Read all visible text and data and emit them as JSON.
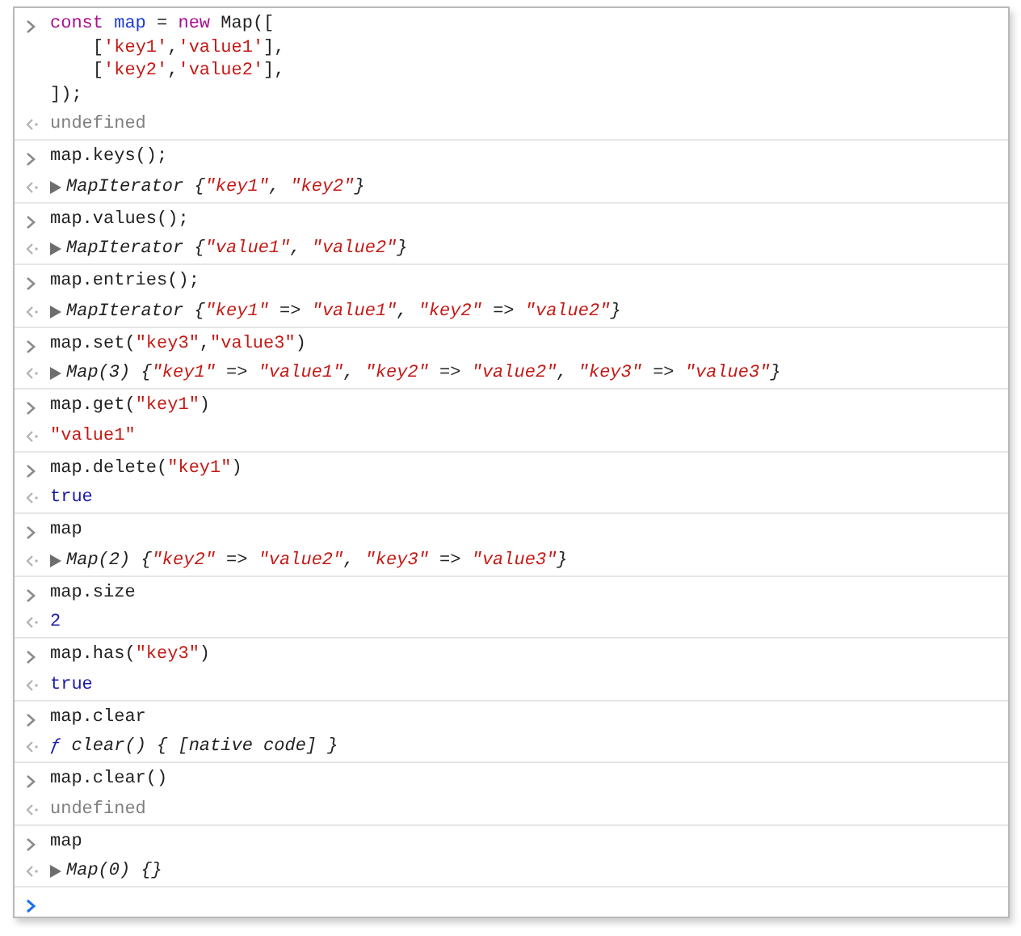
{
  "console": {
    "entries": [
      {
        "input": [
          [
            {
              "text": "const ",
              "kind": "keyword"
            },
            {
              "text": "map",
              "kind": "def"
            },
            {
              "text": " = ",
              "kind": "plain"
            },
            {
              "text": "new ",
              "kind": "keyword"
            },
            {
              "text": "Map([",
              "kind": "plain"
            }
          ],
          [
            {
              "text": "    [",
              "kind": "plain"
            },
            {
              "text": "'key1'",
              "kind": "string"
            },
            {
              "text": ",",
              "kind": "plain"
            },
            {
              "text": "'value1'",
              "kind": "string"
            },
            {
              "text": "],",
              "kind": "plain"
            }
          ],
          [
            {
              "text": "    [",
              "kind": "plain"
            },
            {
              "text": "'key2'",
              "kind": "string"
            },
            {
              "text": ",",
              "kind": "plain"
            },
            {
              "text": "'value2'",
              "kind": "string"
            },
            {
              "text": "],",
              "kind": "plain"
            }
          ],
          [
            {
              "text": "]);",
              "kind": "plain"
            }
          ]
        ],
        "output": {
          "kind": "value",
          "expandable": false,
          "tokens": [
            {
              "text": "undefined",
              "kind": "null"
            }
          ]
        }
      },
      {
        "input": [
          [
            {
              "text": "map.keys();",
              "kind": "plain"
            }
          ]
        ],
        "output": {
          "kind": "object",
          "expandable": true,
          "tokens": [
            {
              "text": "MapIterator {",
              "kind": "plain"
            },
            {
              "text": "\"key1\"",
              "kind": "string"
            },
            {
              "text": ", ",
              "kind": "plain"
            },
            {
              "text": "\"key2\"",
              "kind": "string"
            },
            {
              "text": "}",
              "kind": "plain"
            }
          ]
        }
      },
      {
        "input": [
          [
            {
              "text": "map.values();",
              "kind": "plain"
            }
          ]
        ],
        "output": {
          "kind": "object",
          "expandable": true,
          "tokens": [
            {
              "text": "MapIterator {",
              "kind": "plain"
            },
            {
              "text": "\"value1\"",
              "kind": "string"
            },
            {
              "text": ", ",
              "kind": "plain"
            },
            {
              "text": "\"value2\"",
              "kind": "string"
            },
            {
              "text": "}",
              "kind": "plain"
            }
          ]
        }
      },
      {
        "input": [
          [
            {
              "text": "map.entries();",
              "kind": "plain"
            }
          ]
        ],
        "output": {
          "kind": "object",
          "expandable": true,
          "tokens": [
            {
              "text": "MapIterator {",
              "kind": "plain"
            },
            {
              "text": "\"key1\"",
              "kind": "string"
            },
            {
              "text": " => ",
              "kind": "plain"
            },
            {
              "text": "\"value1\"",
              "kind": "string"
            },
            {
              "text": ", ",
              "kind": "plain"
            },
            {
              "text": "\"key2\"",
              "kind": "string"
            },
            {
              "text": " => ",
              "kind": "plain"
            },
            {
              "text": "\"value2\"",
              "kind": "string"
            },
            {
              "text": "}",
              "kind": "plain"
            }
          ]
        }
      },
      {
        "input": [
          [
            {
              "text": "map.set(",
              "kind": "plain"
            },
            {
              "text": "\"key3\"",
              "kind": "string"
            },
            {
              "text": ",",
              "kind": "plain"
            },
            {
              "text": "\"value3\"",
              "kind": "string"
            },
            {
              "text": ")",
              "kind": "plain"
            }
          ]
        ],
        "output": {
          "kind": "object",
          "expandable": true,
          "tokens": [
            {
              "text": "Map(3) {",
              "kind": "plain"
            },
            {
              "text": "\"key1\"",
              "kind": "string"
            },
            {
              "text": " => ",
              "kind": "plain"
            },
            {
              "text": "\"value1\"",
              "kind": "string"
            },
            {
              "text": ", ",
              "kind": "plain"
            },
            {
              "text": "\"key2\"",
              "kind": "string"
            },
            {
              "text": " => ",
              "kind": "plain"
            },
            {
              "text": "\"value2\"",
              "kind": "string"
            },
            {
              "text": ", ",
              "kind": "plain"
            },
            {
              "text": "\"key3\"",
              "kind": "string"
            },
            {
              "text": " => ",
              "kind": "plain"
            },
            {
              "text": "\"value3\"",
              "kind": "string"
            },
            {
              "text": "}",
              "kind": "plain"
            }
          ]
        }
      },
      {
        "input": [
          [
            {
              "text": "map.get(",
              "kind": "plain"
            },
            {
              "text": "\"key1\"",
              "kind": "string"
            },
            {
              "text": ")",
              "kind": "plain"
            }
          ]
        ],
        "output": {
          "kind": "value",
          "expandable": false,
          "tokens": [
            {
              "text": "\"value1\"",
              "kind": "string"
            }
          ]
        }
      },
      {
        "input": [
          [
            {
              "text": "map.delete(",
              "kind": "plain"
            },
            {
              "text": "\"key1\"",
              "kind": "string"
            },
            {
              "text": ")",
              "kind": "plain"
            }
          ]
        ],
        "output": {
          "kind": "value",
          "expandable": false,
          "tokens": [
            {
              "text": "true",
              "kind": "number"
            }
          ]
        }
      },
      {
        "input": [
          [
            {
              "text": "map",
              "kind": "plain"
            }
          ]
        ],
        "output": {
          "kind": "object",
          "expandable": true,
          "tokens": [
            {
              "text": "Map(2) {",
              "kind": "plain"
            },
            {
              "text": "\"key2\"",
              "kind": "string"
            },
            {
              "text": " => ",
              "kind": "plain"
            },
            {
              "text": "\"value2\"",
              "kind": "string"
            },
            {
              "text": ", ",
              "kind": "plain"
            },
            {
              "text": "\"key3\"",
              "kind": "string"
            },
            {
              "text": " => ",
              "kind": "plain"
            },
            {
              "text": "\"value3\"",
              "kind": "string"
            },
            {
              "text": "}",
              "kind": "plain"
            }
          ]
        }
      },
      {
        "input": [
          [
            {
              "text": "map.size",
              "kind": "plain"
            }
          ]
        ],
        "output": {
          "kind": "value",
          "expandable": false,
          "tokens": [
            {
              "text": "2",
              "kind": "number"
            }
          ]
        }
      },
      {
        "input": [
          [
            {
              "text": "map.has(",
              "kind": "plain"
            },
            {
              "text": "\"key3\"",
              "kind": "string"
            },
            {
              "text": ")",
              "kind": "plain"
            }
          ]
        ],
        "output": {
          "kind": "value",
          "expandable": false,
          "tokens": [
            {
              "text": "true",
              "kind": "number"
            }
          ]
        }
      },
      {
        "input": [
          [
            {
              "text": "map.clear",
              "kind": "plain"
            }
          ]
        ],
        "output": {
          "kind": "function",
          "expandable": false,
          "tokens": [
            {
              "text": "ƒ",
              "kind": "number"
            },
            {
              "text": " clear() { [native code] }",
              "kind": "plain"
            }
          ]
        }
      },
      {
        "input": [
          [
            {
              "text": "map.clear()",
              "kind": "plain"
            }
          ]
        ],
        "output": {
          "kind": "value",
          "expandable": false,
          "tokens": [
            {
              "text": "undefined",
              "kind": "null"
            }
          ]
        }
      },
      {
        "input": [
          [
            {
              "text": "map",
              "kind": "plain"
            }
          ]
        ],
        "output": {
          "kind": "object",
          "expandable": true,
          "tokens": [
            {
              "text": "Map(0) {}",
              "kind": "plain"
            }
          ]
        }
      }
    ]
  }
}
